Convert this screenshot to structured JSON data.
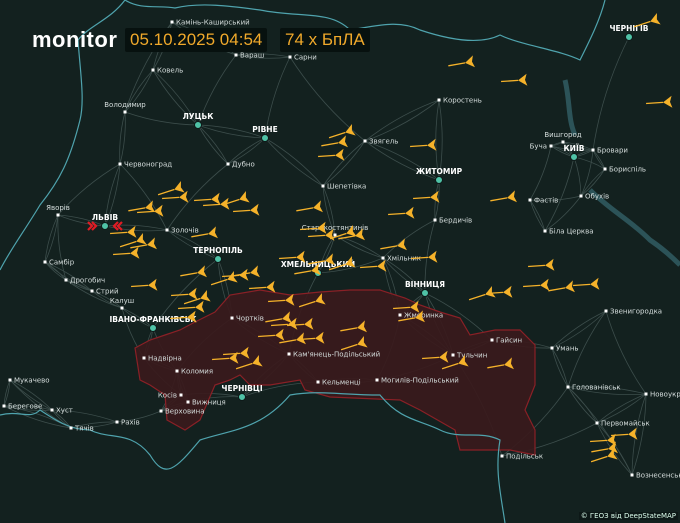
{
  "brand": "monitor",
  "timestamp": "05.10.2025 04:54",
  "threat_count": "74 х БпЛА",
  "attribution": "© ГЕОЗ від DeepStateMAP",
  "colors": {
    "background": "#13211f",
    "border": "#4fa3ad",
    "road": "#3c4d4b",
    "zone": "#3a1a1c",
    "zone_edge": "#7a1e22",
    "drone": "#f5b22a",
    "regional_center": "#4fc2a6",
    "alert": "#e01b24"
  },
  "icons": {
    "drone": "shahed-drone-icon",
    "alert": "explosion-alert-icon"
  },
  "regional_centers": [
    "ЛУЦЬК",
    "РІВНЕ",
    "ЛЬВІВ",
    "ТЕРНОПІЛЬ",
    "ХМЕЛЬНИЦЬКИЙ",
    "ІВАНО-ФРАНКІВСЬК",
    "ЧЕРНІВЦІ",
    "ЖИТОМИР",
    "ВІННИЦЯ",
    "КИЇВ",
    "ЧЕРНІГІВ"
  ],
  "cities": [
    "Камінь-Каширський",
    "Вараш",
    "Сарни",
    "Ковель",
    "Володимир",
    "Червоноград",
    "Дубно",
    "Звягель",
    "Яворів",
    "Золочів",
    "Шепетівка",
    "Самбір",
    "Дрогобич",
    "Стрий",
    "Калуш",
    "Чортків",
    "Старокостянтинів",
    "Кам'янець-Подільський",
    "Надвірна",
    "Коломия",
    "Косів",
    "Вижниця",
    "Верховина",
    "Кельменці",
    "Могилів-Подільський",
    "Мукачево",
    "Берегове",
    "Хуст",
    "Тячів",
    "Рахів",
    "Коростень",
    "Бердичів",
    "Хмільник",
    "Жмеринка",
    "Вишгород",
    "Буча",
    "Бровари",
    "Бориспіль",
    "Фастів",
    "Обухів",
    "Біла Церква",
    "Гайсин",
    "Тульчин",
    "Умань",
    "Звенигородка",
    "Голованівськ",
    "Новоукраїнка",
    "Первомайськ",
    "Вознесенськ",
    "Подільськ"
  ]
}
